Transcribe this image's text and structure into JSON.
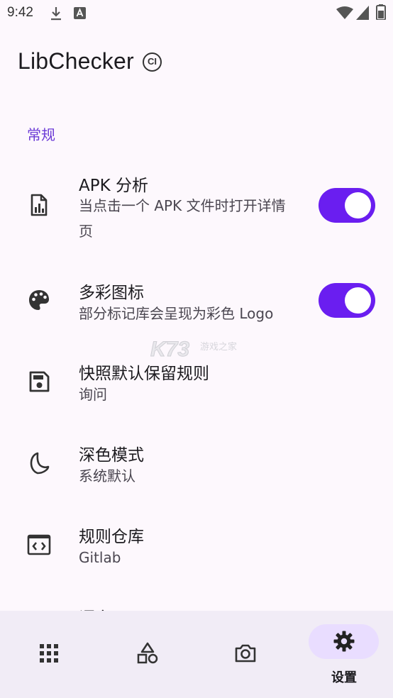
{
  "status_bar": {
    "time": "9:42",
    "icons": [
      "download-icon",
      "notification-a-icon",
      "wifi-icon",
      "cell-signal-icon",
      "battery-icon"
    ]
  },
  "app_bar": {
    "title": "LibChecker",
    "badge": "CI"
  },
  "section": {
    "header": "常规",
    "accent_color": "#6b3ad6"
  },
  "preferences": [
    {
      "title": "APK 分析",
      "summary": "当点击一个 APK 文件时打开详情页",
      "icon": "apk-analysis-icon",
      "switch_on": true
    },
    {
      "title": "多彩图标",
      "summary": "部分标记库会呈现为彩色 Logo",
      "icon": "palette-icon",
      "switch_on": true
    },
    {
      "title": "快照默认保留规则",
      "summary": "询问",
      "icon": "save-icon"
    },
    {
      "title": "深色模式",
      "summary": "系统默认",
      "icon": "dark-mode-icon"
    },
    {
      "title": "规则仓库",
      "summary": "Gitlab",
      "icon": "code-repo-icon"
    },
    {
      "title": "语言",
      "summary": "",
      "icon": ""
    }
  ],
  "watermark": {
    "main": "K73",
    "sub": "游戏之家"
  },
  "bottom_nav": {
    "items": [
      {
        "icon": "apps-grid-icon",
        "label": ""
      },
      {
        "icon": "shapes-icon",
        "label": ""
      },
      {
        "icon": "camera-icon",
        "label": ""
      },
      {
        "icon": "settings-gear-icon",
        "label": "设置",
        "selected": true
      }
    ]
  },
  "colors": {
    "switch_track": "#6a1ef0",
    "background": "#fdf8fd",
    "nav_background": "#f1ecf6",
    "nav_selected_pill": "#e9ddff"
  }
}
